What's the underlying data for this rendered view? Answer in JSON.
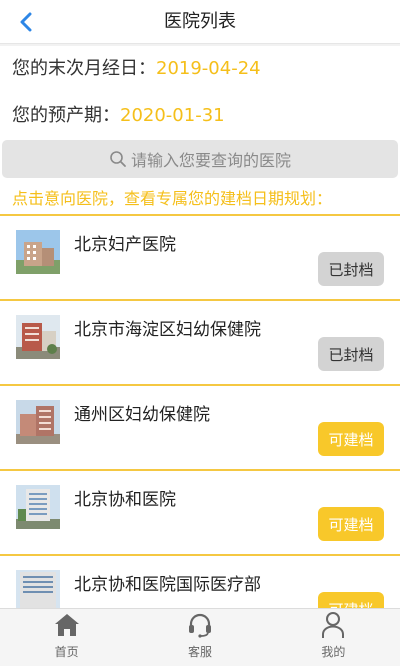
{
  "header": {
    "title": "医院列表",
    "back_icon": "chevron-left-icon"
  },
  "info": {
    "last_period_label": "您的末次月经日：",
    "last_period_value": "2019-04-24",
    "due_date_label": "您的预产期：",
    "due_date_value": "2020-01-31"
  },
  "search": {
    "placeholder": "请输入您要查询的医院",
    "icon": "search-icon"
  },
  "hint": "点击意向医院，查看专属您的建档日期规划：",
  "hospitals": [
    {
      "name": "北京妇产医院",
      "status": "已封档"
    },
    {
      "name": "北京市海淀区妇幼保健院",
      "status": "已封档"
    },
    {
      "name": "通州区妇幼保健院",
      "status": "可建档"
    },
    {
      "name": "北京协和医院",
      "status": "可建档"
    },
    {
      "name": "北京协和医院国际医疗部",
      "status": "可建档"
    }
  ],
  "tabs": [
    {
      "label": "首页",
      "icon": "home-icon"
    },
    {
      "label": "客服",
      "icon": "headset-icon"
    },
    {
      "label": "我的",
      "icon": "user-icon"
    }
  ],
  "colors": {
    "accent": "#f5bf1a",
    "closed_button": "#d3d3d3",
    "open_button": "#f8c82a"
  }
}
